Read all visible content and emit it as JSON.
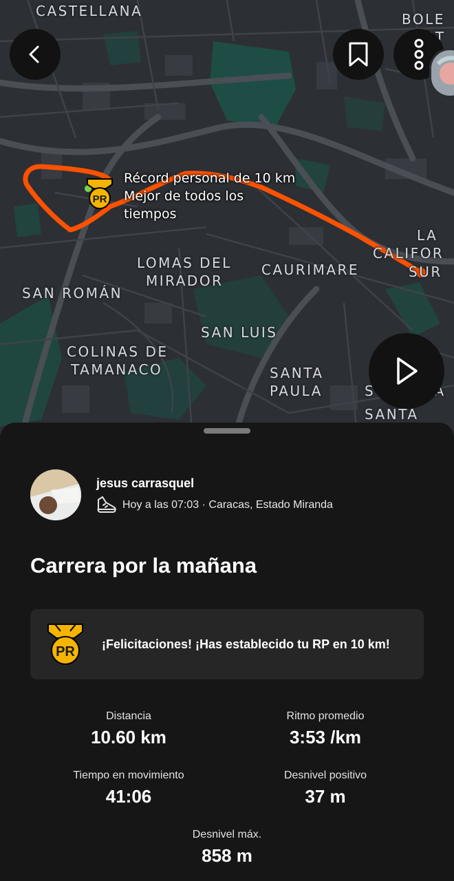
{
  "map": {
    "labels": {
      "castellana": "CASTELLANA",
      "bole": "BOLE",
      "rt": "RT",
      "la": "LA",
      "califor": "CALIFOR",
      "sur": "SUR",
      "lomas": "LOMAS DEL",
      "mirador": "MIRADOR",
      "caurimare": "CAURIMARE",
      "san_roman": "SAN ROMÁN",
      "san_luis": "SAN LUIS",
      "colinas": "COLINAS DE",
      "tamanaco": "TAMANACO",
      "santa1": "SANTA",
      "paula": "PAULA",
      "s": "S",
      "na": "NA",
      "santa2": "SANTA"
    },
    "pr_badge_text": "PR",
    "pr_callout": {
      "line1": "Récord personal de 10 km",
      "line2": "Mejor de todos los",
      "line3": "tiempos"
    },
    "route_color": "#fc5200",
    "buttons": {
      "back_icon": "chevron-left-icon",
      "bookmark_icon": "bookmark-icon",
      "more_icon": "more-vertical-icon",
      "play_icon": "play-icon"
    }
  },
  "activity": {
    "athlete_name": "jesus carrasquel",
    "meta_text": "Hoy a las 07:03 · Caracas, Estado Miranda",
    "sport_icon": "running-shoe-icon",
    "title": "Carrera por la mañana",
    "congrats_badge_text": "PR",
    "congrats_text": "¡Felicitaciones! ¡Has establecido tu RP en 10 km!",
    "stats": {
      "distance": {
        "label": "Distancia",
        "value": "10.60 km"
      },
      "avg_pace": {
        "label": "Ritmo promedio",
        "value": "3:53 /km"
      },
      "moving_time": {
        "label": "Tiempo en movimiento",
        "value": "41:06"
      },
      "elev_gain": {
        "label": "Desnivel positivo",
        "value": "37 m"
      },
      "max_elev": {
        "label": "Desnivel máx.",
        "value": "858 m"
      }
    }
  },
  "colors": {
    "accent": "#fc5200",
    "pr_gold": "#f5b400",
    "background": "#161616",
    "card": "#262626"
  }
}
